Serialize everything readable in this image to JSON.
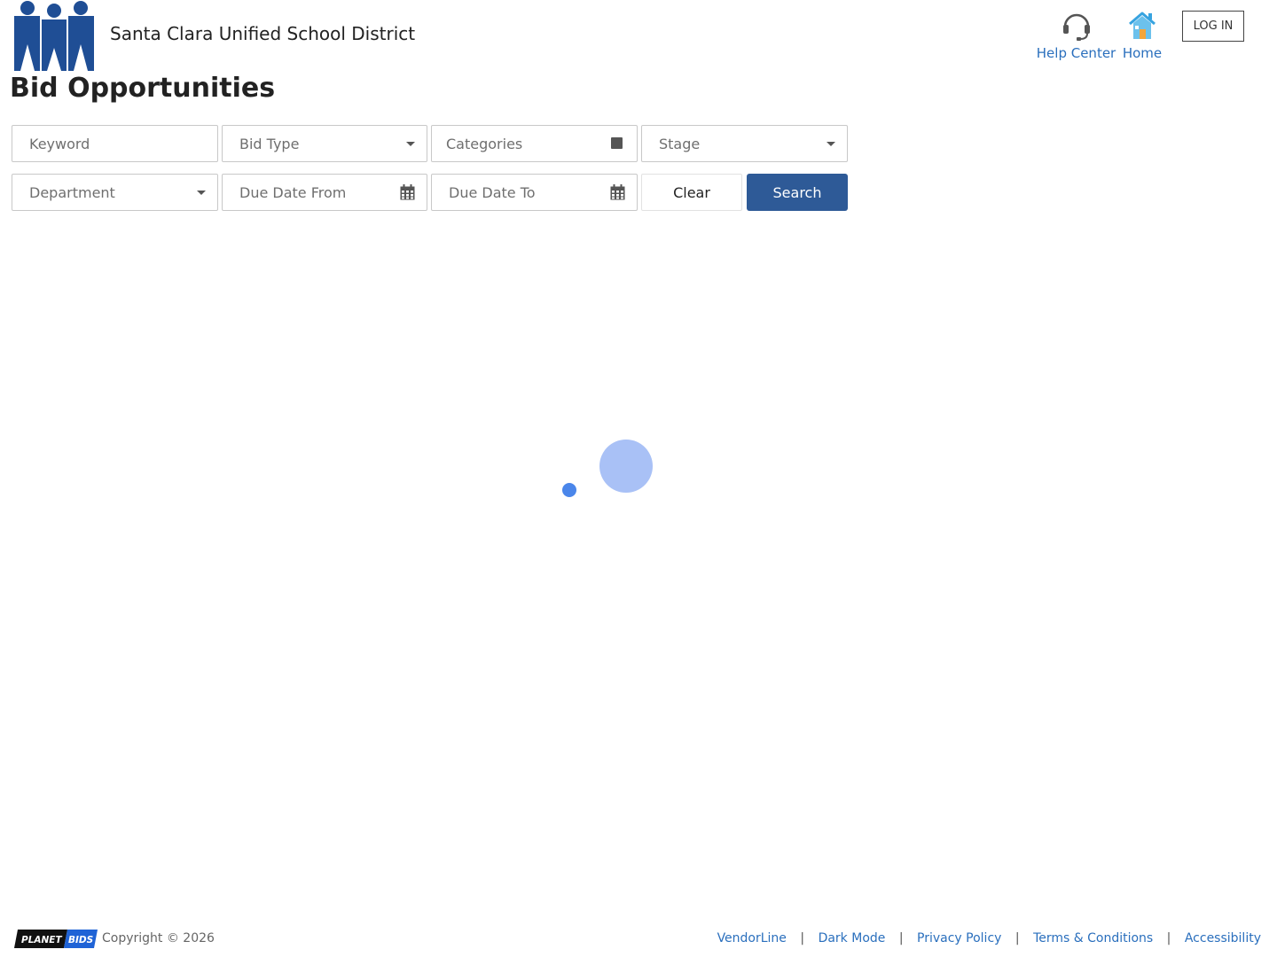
{
  "header": {
    "district_name": "Santa Clara Unified School District",
    "page_title": "Bid Opportunities",
    "help_center_label": "Help Center",
    "home_label": "Home",
    "login_label": "LOG IN"
  },
  "filters": {
    "keyword_placeholder": "Keyword",
    "bid_type": "Bid Type",
    "categories": "Categories",
    "stage": "Stage",
    "department": "Department",
    "due_date_from": "Due Date From",
    "due_date_to": "Due Date To",
    "clear_label": "Clear",
    "search_label": "Search"
  },
  "footer": {
    "brand": {
      "planet": "PLANET",
      "bids": "BIDS"
    },
    "copyright": "Copyright © 2026",
    "links": {
      "vendorline": "VendorLine",
      "dark_mode": "Dark Mode",
      "privacy_policy": "Privacy Policy",
      "terms": "Terms & Conditions",
      "accessibility": "Accessibility"
    },
    "separator": "|"
  },
  "icons": {
    "district_logo": "district-logo-icon",
    "help": "headset-icon",
    "home": "house-icon",
    "dropdown": "caret-down-icon",
    "categories": "square-icon",
    "date": "calendar-icon",
    "loading": "loading-spinner"
  },
  "colors": {
    "brand_dark_blue": "#1f4e95",
    "link_blue": "#2a6fbd",
    "search_button": "#2e5a97",
    "home_icon_blue": "#37a3e0",
    "home_icon_orange": "#f4a53a",
    "spinner_light": "#a9c1f6",
    "spinner_dark": "#4a86ea",
    "planetbids_black": "#111111",
    "planetbids_blue": "#1f63d6"
  }
}
